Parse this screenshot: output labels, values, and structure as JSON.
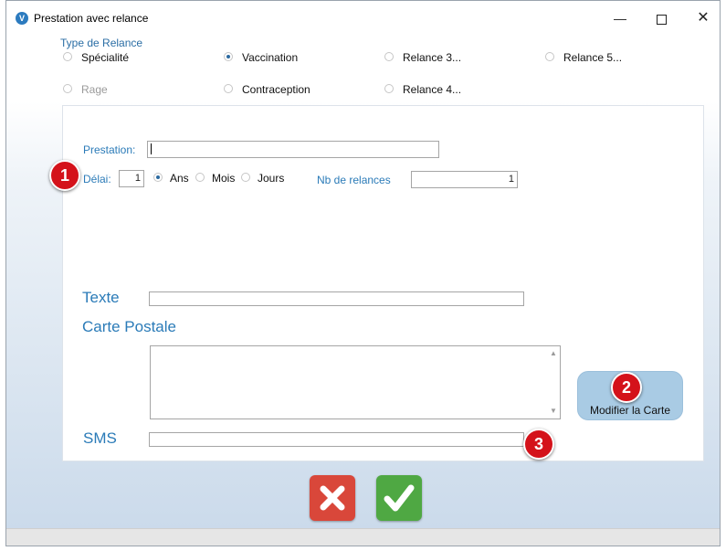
{
  "window": {
    "title": "Prestation avec relance",
    "app_icon_letter": "V",
    "controls": {
      "minimize": "—",
      "close": "✕"
    }
  },
  "relance_type": {
    "label": "Type de Relance",
    "options": [
      {
        "label": "Spécialité",
        "checked": false,
        "enabled": true
      },
      {
        "label": "Vaccination",
        "checked": true,
        "enabled": true
      },
      {
        "label": "Relance 3...",
        "checked": false,
        "enabled": true
      },
      {
        "label": "Relance 5...",
        "checked": false,
        "enabled": true
      },
      {
        "label": "Rage",
        "checked": false,
        "enabled": false
      },
      {
        "label": "Contraception",
        "checked": false,
        "enabled": true
      },
      {
        "label": "Relance 4...",
        "checked": false,
        "enabled": true
      }
    ]
  },
  "form": {
    "prestation_label": "Prestation:",
    "prestation_value": "",
    "delai_label": "Délai:",
    "delai_value": "1",
    "delai_units": [
      {
        "label": "Ans",
        "checked": true
      },
      {
        "label": "Mois",
        "checked": false
      },
      {
        "label": "Jours",
        "checked": false
      }
    ],
    "nb_relances_label": "Nb de relances",
    "nb_relances_value": "1",
    "texte_label": "Texte",
    "texte_value": "",
    "carte_postale_label": "Carte Postale",
    "carte_postale_value": "",
    "sms_label": "SMS",
    "sms_value": "",
    "modify_card_button": "Modifier la Carte"
  },
  "badges": [
    "1",
    "2",
    "3"
  ],
  "actions": {
    "cancel_icon": "cancel-x-icon",
    "ok_icon": "checkmark-icon"
  },
  "colors": {
    "accent": "#2b7bb8",
    "cancel": "#d9473a",
    "ok": "#4fa843",
    "badge": "#d4121a"
  }
}
